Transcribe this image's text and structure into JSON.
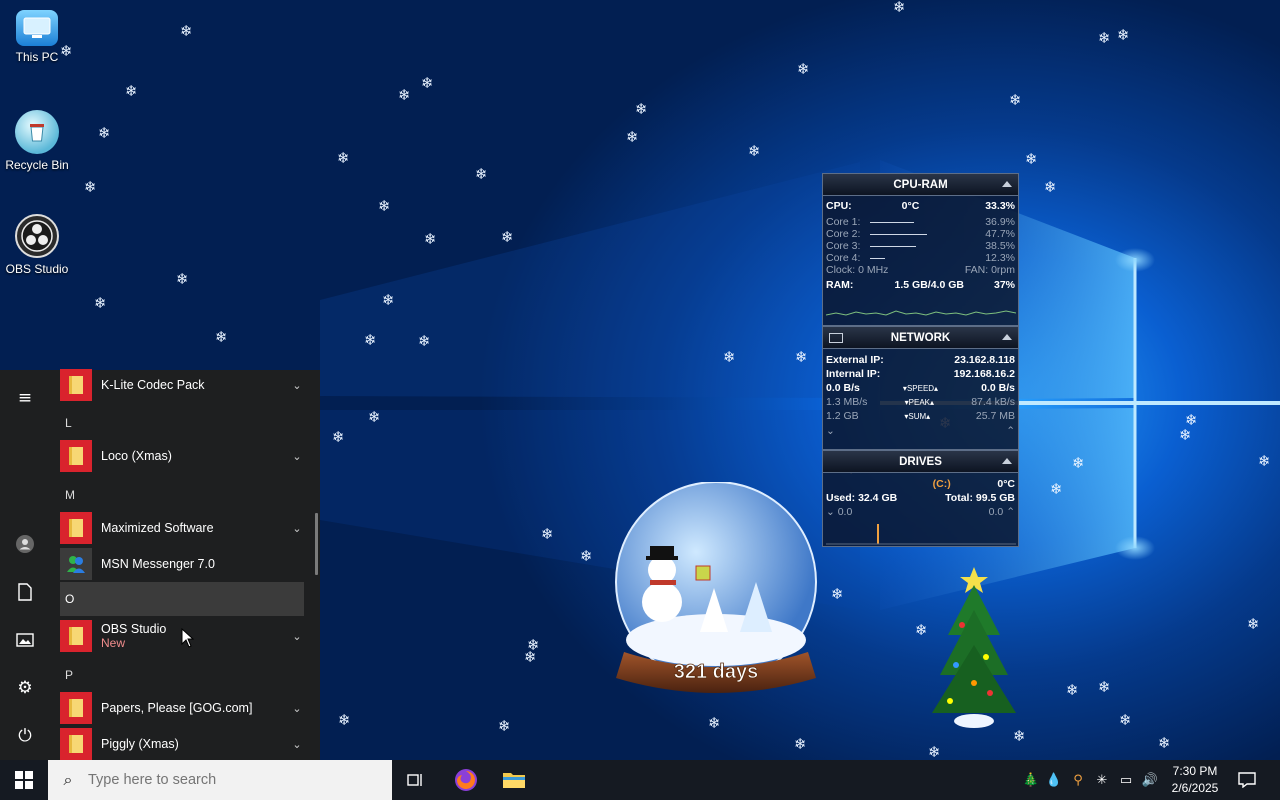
{
  "desktop": {
    "icons": [
      {
        "label": "This PC"
      },
      {
        "label": "Recycle Bin"
      },
      {
        "label": "OBS Studio"
      }
    ]
  },
  "gadgets": {
    "cpu": {
      "title": "CPU-RAM",
      "cpu_label": "CPU:",
      "cpu_temp": "0°C",
      "cpu_pct": "33.3%",
      "cores": [
        {
          "label": "Core 1:",
          "value": "36.9%",
          "level": 0.369
        },
        {
          "label": "Core 2:",
          "value": "47.7%",
          "level": 0.477
        },
        {
          "label": "Core 3:",
          "value": "38.5%",
          "level": 0.385
        },
        {
          "label": "Core 4:",
          "value": "12.3%",
          "level": 0.123
        }
      ],
      "clock": "Clock: 0 MHz",
      "fan": "FAN: 0rpm",
      "ram_label": "RAM:",
      "ram_usage": "1.5 GB/4.0 GB",
      "ram_pct": "37%"
    },
    "network": {
      "title": "NETWORK",
      "external_label": "External IP:",
      "external_ip": "23.162.8.118",
      "internal_label": "Internal IP:",
      "internal_ip": "192.168.16.2",
      "speed_down": "0.0 B/s",
      "speed_label": "▾SPEED▴",
      "speed_up": "0.0 B/s",
      "peak_down": "1.3 MB/s",
      "peak_label": "▾PEAK▴",
      "peak_up": "87.4 kB/s",
      "sum_down": "1.2 GB",
      "sum_label": "▾SUM▴",
      "sum_up": "25.7 MB"
    },
    "drives": {
      "title": "DRIVES",
      "drive": "(C:)",
      "temp": "0°C",
      "used": "Used: 32.4 GB",
      "total": "Total: 99.5 GB",
      "read": "0.0",
      "write": "0.0"
    }
  },
  "snowglobe": {
    "days": "321 days"
  },
  "start_menu": {
    "letters": {
      "L": "L",
      "M": "M",
      "O": "O",
      "P": "P"
    },
    "apps": [
      {
        "name": "K-Lite Codec Pack"
      },
      {
        "name": "Loco (Xmas)"
      },
      {
        "name": "Maximized Software"
      },
      {
        "name": "MSN Messenger 7.0"
      },
      {
        "name": "OBS Studio",
        "badge": "New"
      },
      {
        "name": "Papers, Please [GOG.com]"
      },
      {
        "name": "Piggly (Xmas)"
      }
    ]
  },
  "taskbar": {
    "search_placeholder": "Type here to search",
    "clock_time": "7:30 PM",
    "clock_date": "2/6/2025"
  },
  "colors": {
    "start_tile": "#d9232d",
    "accent": "#0a5fd1"
  }
}
